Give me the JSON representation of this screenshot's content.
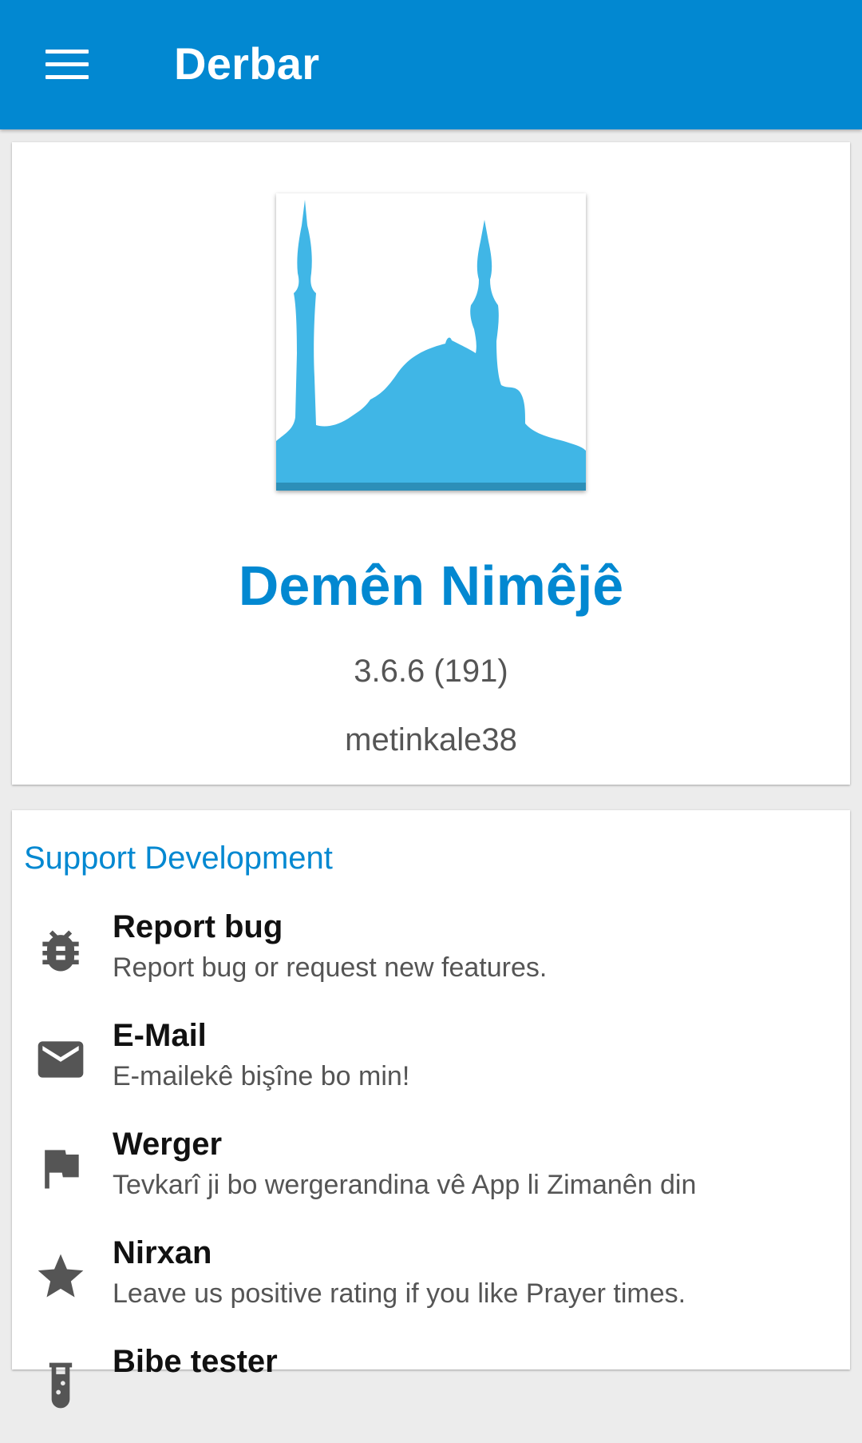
{
  "appbar": {
    "title": "Derbar",
    "menu_icon": "hamburger-menu-icon"
  },
  "about": {
    "app_icon": "mosque-icon",
    "app_name": "Demên Nimêjê",
    "version": "3.6.6 (191)",
    "author": "metinkale38"
  },
  "support": {
    "section_title": "Support Development",
    "items": [
      {
        "icon": "bug-icon",
        "title": "Report bug",
        "subtitle": "Report bug or request new features."
      },
      {
        "icon": "email-icon",
        "title": "E-Mail",
        "subtitle": "E-mailekê bişîne bo min!"
      },
      {
        "icon": "flag-icon",
        "title": "Werger",
        "subtitle": "Tevkarî ji bo wergerandina vê App li Zimanên din"
      },
      {
        "icon": "star-icon",
        "title": "Nirxan",
        "subtitle": "Leave us positive rating if you like Prayer times."
      },
      {
        "icon": "beta-icon",
        "title": "Bibe tester",
        "subtitle": ""
      }
    ]
  },
  "colors": {
    "primary": "#0288d1",
    "icon_blue": "#40b6e6",
    "icon_grey": "#555555",
    "background": "#ececec"
  }
}
